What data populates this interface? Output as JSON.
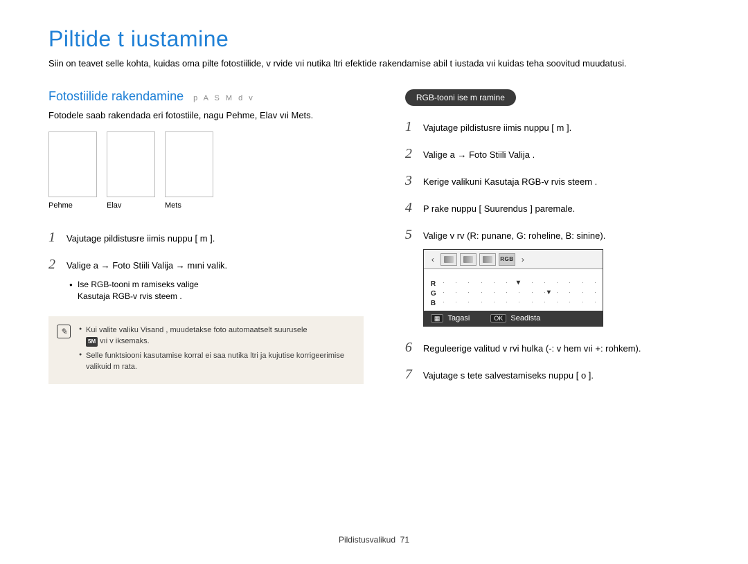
{
  "title": "Piltide t iustamine",
  "intro": "Siin on teavet selle kohta, kuidas oma pilte fotostiilide, v rvide vıi nutika   ltri efektide rakendamise abil t iustada vıi kuidas teha soovitud muudatusi.",
  "left": {
    "section_title": "Fotostiilide rakendamine",
    "modes": "p A S M d v",
    "desc": "Fotodele saab rakendada eri fotostiile, nagu Pehme, Elav vıi Mets.",
    "thumbs": {
      "a": "Pehme",
      "b": "Elav",
      "c": "Mets"
    },
    "step1": "Vajutage pildistusre iimis nuppu [ m       ].",
    "step2": "Valige a   → Foto Stiili Valija  → mıni valik.",
    "sub_a": "Ise RGB-tooni m  ramiseks valige",
    "sub_b": "Kasutaja RGB-v rvis steem   .",
    "note_a": "Kui valite valiku Visand , muudetakse foto automaatselt suurusele",
    "note_a2": " vıi v iksemaks.",
    "note_size": "5M",
    "note_b": "Selle funktsiooni kasutamise korral ei saa nutika  ltri ja kujutise korrigeerimise valikuid m  rata."
  },
  "right": {
    "pill": "RGB-tooni ise m  ramine",
    "step1": "Vajutage pildistusre iimis nuppu [ m       ].",
    "step2": "Valige a   → Foto Stiili Valija .",
    "step3": "Kerige valikuni Kasutaja RGB-v rvis steem    .",
    "step4": "P  rake nuppu [  Suurendus ] paremale.",
    "step5": "Valige v rv (R: punane, G: roheline, B: sinine).",
    "step6": "Reguleerige valitud v rvi hulka (-: v hem vıi +: rohkem).",
    "step7": "Vajutage s tete salvestamiseks nuppu [ o ].",
    "screenshot": {
      "tab_rgb": "RGB",
      "r": "R",
      "g": "G",
      "b": "B",
      "back_key": "▦",
      "back": "Tagasi",
      "ok_key": "OK",
      "ok": "Seadista"
    }
  },
  "footer": {
    "section": "Pildistusvalikud",
    "page": "71"
  }
}
